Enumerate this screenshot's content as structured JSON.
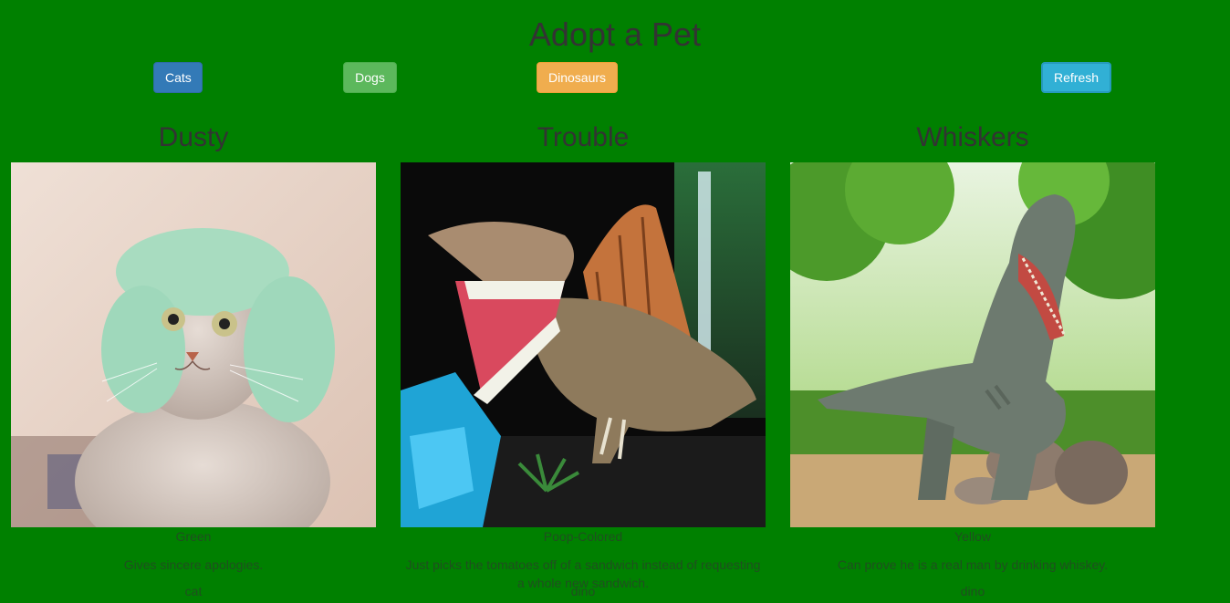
{
  "header": {
    "title": "Adopt a Pet"
  },
  "toolbar": {
    "cats_label": "Cats",
    "dogs_label": "Dogs",
    "dinosaurs_label": "Dinosaurs",
    "refresh_label": "Refresh"
  },
  "colors": {
    "background": "#008000",
    "cats_button": "#337ab7",
    "dogs_button": "#5cb85c",
    "dinosaurs_button": "#f0ad4e",
    "refresh_button": "#31b0d5"
  },
  "pets": [
    {
      "name": "Dusty",
      "color": "Green",
      "description": "Gives sincere apologies.",
      "type": "cat",
      "image_icon": "cat-photo"
    },
    {
      "name": "Trouble",
      "color": "Poop-Colored",
      "description": "Just picks the tomatoes off of a sandwich instead of requesting a whole new sandwich.",
      "type": "dino",
      "image_icon": "spinosaurus-photo"
    },
    {
      "name": "Whiskers",
      "color": "Yellow",
      "description": "Can prove he is a real man by drinking whiskey.",
      "type": "dino",
      "image_icon": "t-rex-photo"
    }
  ]
}
